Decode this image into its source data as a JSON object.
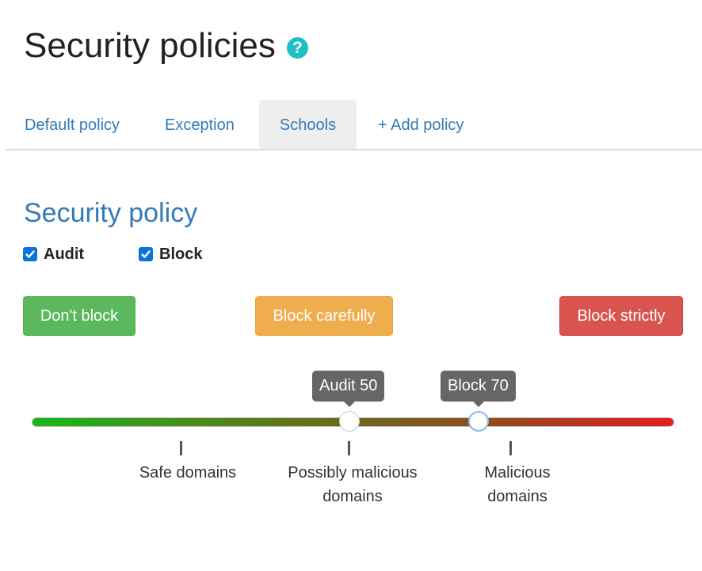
{
  "header": {
    "title": "Security policies",
    "help_icon": "?"
  },
  "tabs": [
    {
      "label": "Default policy",
      "active": false
    },
    {
      "label": "Exception",
      "active": false
    },
    {
      "label": "Schools",
      "active": true
    },
    {
      "label": "+ Add policy",
      "active": false
    }
  ],
  "policy": {
    "title": "Security policy",
    "checkboxes": [
      {
        "label": "Audit",
        "checked": true
      },
      {
        "label": "Block",
        "checked": true
      }
    ],
    "presets": {
      "dont_block": "Don't block",
      "block_carefully": "Block carefully",
      "block_strictly": "Block strictly"
    }
  },
  "slider": {
    "handles": [
      {
        "label": "Audit 50",
        "value": 50
      },
      {
        "label": "Block 70",
        "value": 70
      }
    ],
    "ticks": [
      {
        "line1": "Safe domains",
        "line2": ""
      },
      {
        "line1": "Possibly malicious",
        "line2": "domains"
      },
      {
        "line1": "Malicious",
        "line2": "domains"
      }
    ]
  },
  "colors": {
    "link": "#337ab7",
    "help": "#1fbfc6",
    "green": "#5cb85c",
    "orange": "#f0ad4e",
    "red": "#d9534f",
    "tooltip": "#666666"
  }
}
